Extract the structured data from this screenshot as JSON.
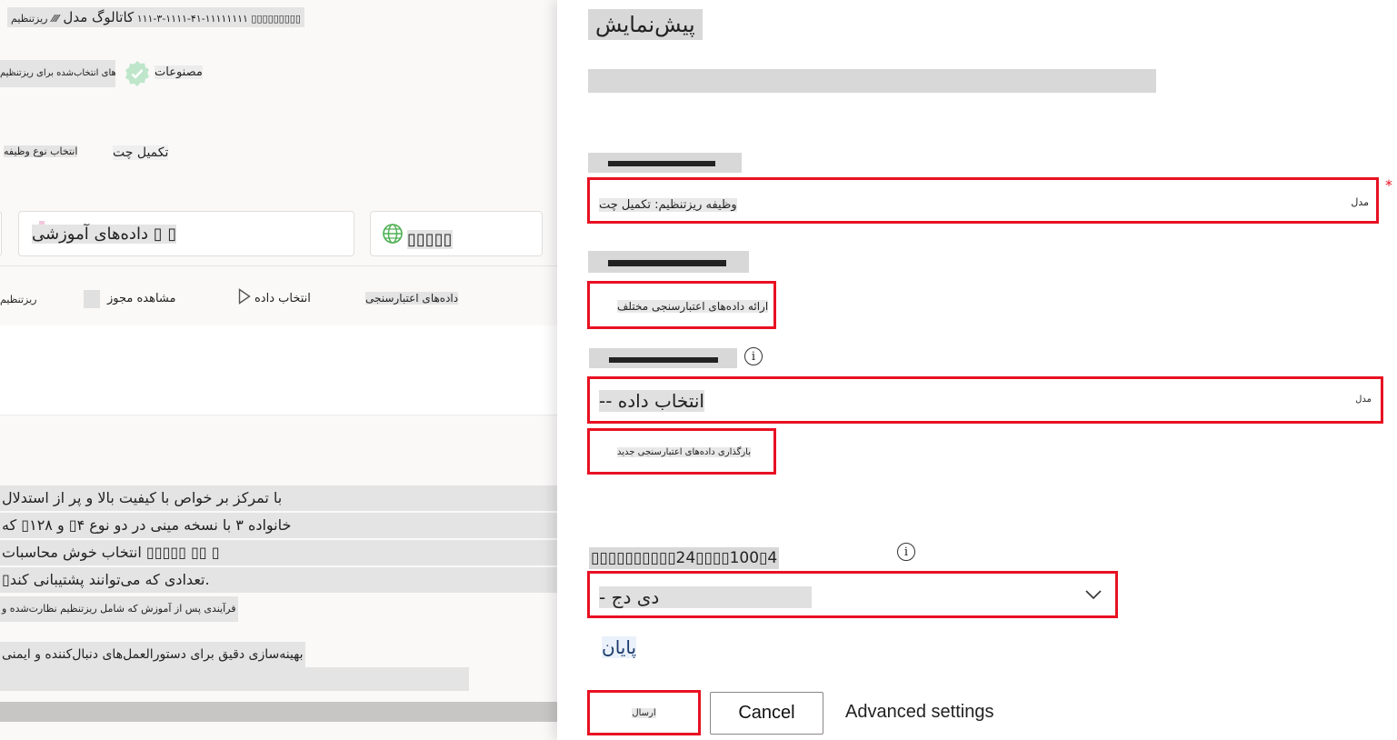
{
  "catalog": {
    "breadcrumb_title": "کاتالوگ مدل",
    "breadcrumb_sep": "⁄⁄⁄⁄",
    "breadcrumb_job": "ریزتنظیم ‎۱۱۱-۳-۱۱۱۱-۴۱-۱۱۱۱۱۱۱۱ ▯▯▯▯▯▯▯▯▯",
    "badge_text": "مصنوعات",
    "badge_side_text": "مدل‌های انتخاب‌شده برای ریزتنظیم",
    "task_label": "انتخاب نوع وظیفه",
    "task_value": "تکمیل چت",
    "card_training_label": "داده‌های آموزشی",
    "card_training_marks": "▯ ▯",
    "card_web_label": "▯▯▯▯▯",
    "tabs": [
      {
        "label": "ریزتنظیم"
      },
      {
        "label": "مشاهده مجوز"
      },
      {
        "label": "انتخاب داده"
      },
      {
        "label": "داده‌های اعتبارسنجی"
      }
    ],
    "description_lines": [
      "با تمرکز بر خواص با کیفیت بالا و پر از استدلال",
      "خانواده ۳ با نسخه مینی در دو نوع ۴▯ و ۱۲۸▯ که",
      "انتخاب خوش محاسبات ▯▯▯▯▯ ▯▯ ▯",
      "▯تعدادی که می‌توانند پشتیبانی کند."
    ],
    "description_small": "فرآیندی پس از آموزش که شامل ریزتنظیم نظارت‌شده و",
    "description_line2": "بهینه‌سازی دقیق برای دستورالعمل‌های دنبال‌کننده و ایمنی"
  },
  "panel": {
    "title": "پیش‌نمایش",
    "subtitle": "",
    "task_field_value": "وظیفه ریزتنظیم: تکمیل چت",
    "task_field_suffix": "مدل",
    "required_mark": "*",
    "training_box_text": "ارائه داده‌های اعتبارسنجی مختلف",
    "validation_select_value": "-- انتخاب داده",
    "validation_select_suffix": "مدل",
    "upload_box_text": "بارگذاری داده‌های اعتبارسنجی جدید",
    "epochs_label": "▯▯▯▯▯▯▯▯▯▯24▯▯▯▯100▯4",
    "epochs_dropdown_value": "- دی دج",
    "link_text": "پایان",
    "submit_label": "ارسال",
    "cancel_label": "Cancel",
    "advanced_label": "Advanced settings",
    "info_icon_glyph": "i",
    "colors": {
      "accent_red": "#e81123",
      "panel_bg": "#ffffff"
    }
  }
}
